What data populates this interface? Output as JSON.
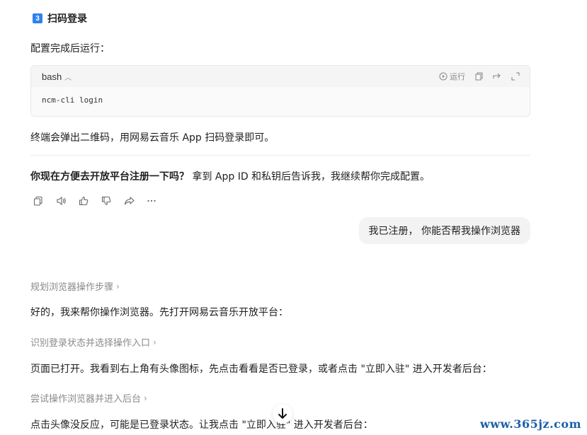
{
  "step": {
    "number": "3",
    "title": "扫码登录"
  },
  "intro": "配置完成后运行：",
  "code": {
    "lang": "bash",
    "run_label": "运行",
    "command": "ncm-cli login"
  },
  "after_code": "终端会弹出二维码，用网易云音乐 App 扫码登录即可。",
  "question": {
    "bold": "你现在方便去开放平台注册一下吗？",
    "rest": " 拿到 App ID 和私钥后告诉我，我继续帮你完成配置。"
  },
  "user_message": "我已注册， 你能否帮我操作浏览器",
  "steps": [
    {
      "link": "规划浏览器操作步骤",
      "text": "好的，我来帮你操作浏览器。先打开网易云音乐开放平台："
    },
    {
      "link": "识别登录状态并选择操作入口",
      "text": "页面已打开。我看到右上角有头像图标，先点击看看是否已登录，或者点击 \"立即入驻\" 进入开发者后台："
    },
    {
      "link": "尝试操作浏览器并进入后台",
      "text": "点击头像没反应，可能是已登录状态。让我点击 \"立即入驻\" 进入开发者后台："
    }
  ],
  "watermark": "www.365jz.com",
  "colors": {
    "accent": "#2f80ed",
    "muted": "#8a8a8a",
    "bubble": "#f3f3f4"
  }
}
